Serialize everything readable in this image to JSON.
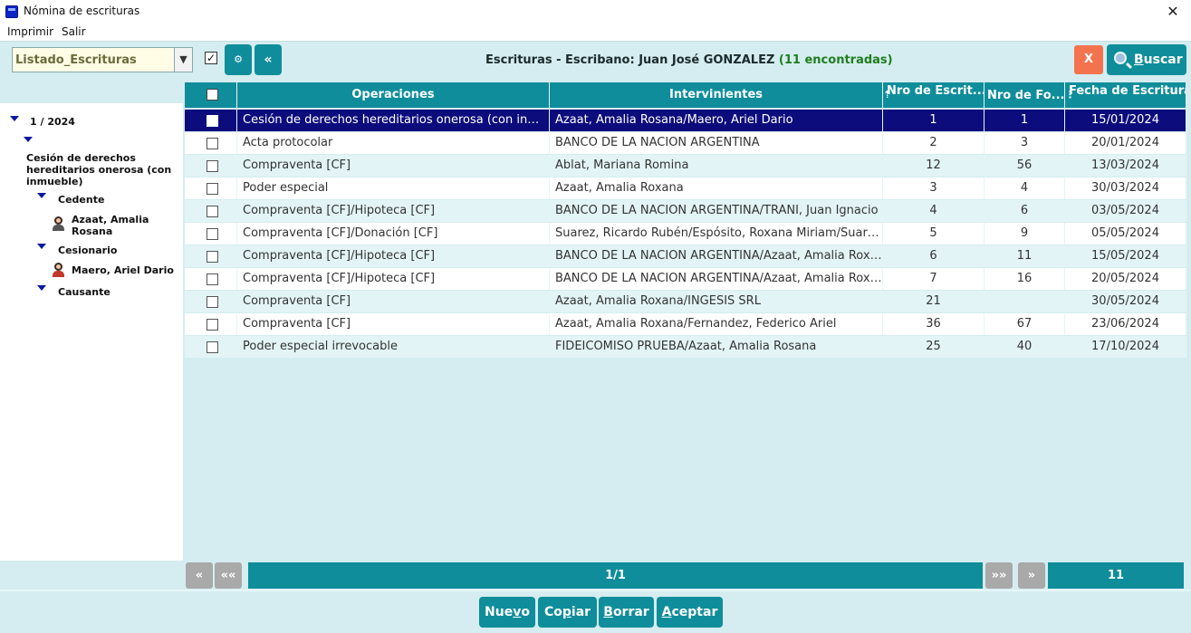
{
  "window": {
    "title": "Nómina de escrituras"
  },
  "menu": [
    "Imprimir",
    "Salir"
  ],
  "toolbar": {
    "listado_value": "Listado_Escrituras",
    "checkbox_mark": "✓",
    "settings_glyph": "⚙",
    "collapse_glyph": "«",
    "title": "Escrituras - Escribano: Juan José GONZALEZ",
    "found": "(11 encontradas)",
    "clear_label": "X",
    "search_label": "Buscar",
    "search_accel": "B",
    "search_rest": "uscar"
  },
  "tree": {
    "root": "1 / 2024",
    "operation": "Cesión de derechos hereditarios onerosa (con inmueble)",
    "roles": [
      {
        "label": "Cedente",
        "person": "Azaat, Amalia Rosana",
        "icon": "female-person-icon"
      },
      {
        "label": "Cesionario",
        "person": "Maero, Ariel Dario",
        "icon": "male-person-icon"
      },
      {
        "label": "Causante",
        "person": "",
        "icon": ""
      }
    ]
  },
  "grid": {
    "headers": [
      "Operaciones",
      "Intervinientes",
      "Nro de Escrit...",
      "Nro de Fo...",
      "Fecha de Escritura"
    ],
    "rows": [
      [
        "Cesión de derechos hereditarios onerosa (con inmueble)",
        "Azaat, Amalia Rosana/Maero, Ariel Dario",
        "1",
        "1",
        "15/01/2024"
      ],
      [
        "Acta protocolar",
        "BANCO DE LA NACION ARGENTINA",
        "2",
        "3",
        "20/01/2024"
      ],
      [
        "Compraventa [CF]",
        "Ablat, Mariana Romina",
        "12",
        "56",
        "13/03/2024"
      ],
      [
        "Poder especial",
        "Azaat, Amalia Roxana",
        "3",
        "4",
        "30/03/2024"
      ],
      [
        "Compraventa [CF]/Hipoteca [CF]",
        "BANCO DE LA NACION ARGENTINA/TRANI, Juan Ignacio",
        "4",
        "6",
        "03/05/2024"
      ],
      [
        "Compraventa [CF]/Donación [CF]",
        "Suarez, Ricardo Rubén/Espósito, Roxana Miriam/Suarez, Ricardo",
        "5",
        "9",
        "05/05/2024"
      ],
      [
        "Compraventa [CF]/Hipoteca [CF]",
        "BANCO DE LA NACION ARGENTINA/Azaat, Amalia Roxana/Otros",
        "6",
        "11",
        "15/05/2024"
      ],
      [
        "Compraventa [CF]/Hipoteca [CF]",
        "BANCO DE LA NACION ARGENTINA/Azaat, Amalia Roxana",
        "7",
        "16",
        "20/05/2024"
      ],
      [
        "Compraventa [CF]",
        "Azaat, Amalia Roxana/INGESIS SRL",
        "21",
        "",
        "30/05/2024"
      ],
      [
        "Compraventa [CF]",
        "Azaat, Amalia Roxana/Fernandez, Federico Ariel",
        "36",
        "67",
        "23/06/2024"
      ],
      [
        "Poder especial irrevocable",
        "FIDEICOMISO PRUEBA/Azaat, Amalia Rosana",
        "25",
        "40",
        "17/10/2024"
      ]
    ],
    "selected_row": 0
  },
  "pager": {
    "prev": "«",
    "first": "««",
    "page": "1/1",
    "last": "»»",
    "next": "»",
    "total": "11"
  },
  "actions": [
    {
      "accel": "",
      "pre": "Nue",
      "u": "v",
      "post": "o"
    },
    {
      "accel": "",
      "pre": "Co",
      "u": "p",
      "post": "iar"
    },
    {
      "accel": "",
      "pre": "",
      "u": "B",
      "post": "orrar"
    },
    {
      "accel": "",
      "pre": "",
      "u": "A",
      "post": "ceptar"
    }
  ],
  "colors": {
    "accent": "#0f8d9b",
    "selected_row": "#0c0c7c",
    "found_count": "#1f7d1f",
    "clear_button": "#f4734f",
    "background": "#d5edf0"
  }
}
